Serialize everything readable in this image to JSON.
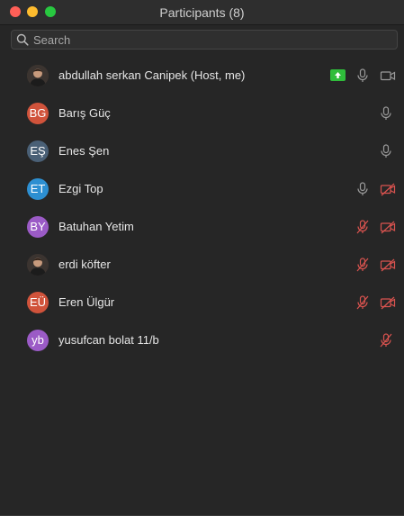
{
  "window": {
    "title": "Participants (8)"
  },
  "search": {
    "placeholder": "Search"
  },
  "colors": {
    "muted_red": "#d9534f",
    "share_green": "#2fbd3b"
  },
  "participants": [
    {
      "name": "abdullah serkan Canipek (Host, me)",
      "initials": "",
      "avatar_type": "photo",
      "avatar_color": "#4a3a2a",
      "screen_share": true,
      "mic": "on",
      "video": "on"
    },
    {
      "name": "Barış Güç",
      "initials": "BG",
      "avatar_type": "initials",
      "avatar_color": "#d0533b",
      "screen_share": false,
      "mic": "on",
      "video": "none"
    },
    {
      "name": "Enes Şen",
      "initials": "EŞ",
      "avatar_type": "initials",
      "avatar_color": "#4a6076",
      "screen_share": false,
      "mic": "on",
      "video": "none"
    },
    {
      "name": "Ezgi Top",
      "initials": "ET",
      "avatar_type": "initials",
      "avatar_color": "#2d8fd1",
      "screen_share": false,
      "mic": "on",
      "video": "off"
    },
    {
      "name": "Batuhan Yetim",
      "initials": "BY",
      "avatar_type": "initials",
      "avatar_color": "#9b5bc6",
      "screen_share": false,
      "mic": "off",
      "video": "off"
    },
    {
      "name": "erdi köfter",
      "initials": "",
      "avatar_type": "photo",
      "avatar_color": "#3a2a2a",
      "screen_share": false,
      "mic": "off",
      "video": "off"
    },
    {
      "name": "Eren Ülgür",
      "initials": "EÜ",
      "avatar_type": "initials",
      "avatar_color": "#d0533b",
      "screen_share": false,
      "mic": "off",
      "video": "off"
    },
    {
      "name": "yusufcan bolat 11/b",
      "initials": "yb",
      "avatar_type": "initials",
      "avatar_color": "#9b5bc6",
      "screen_share": false,
      "mic": "off",
      "video": "none"
    }
  ]
}
